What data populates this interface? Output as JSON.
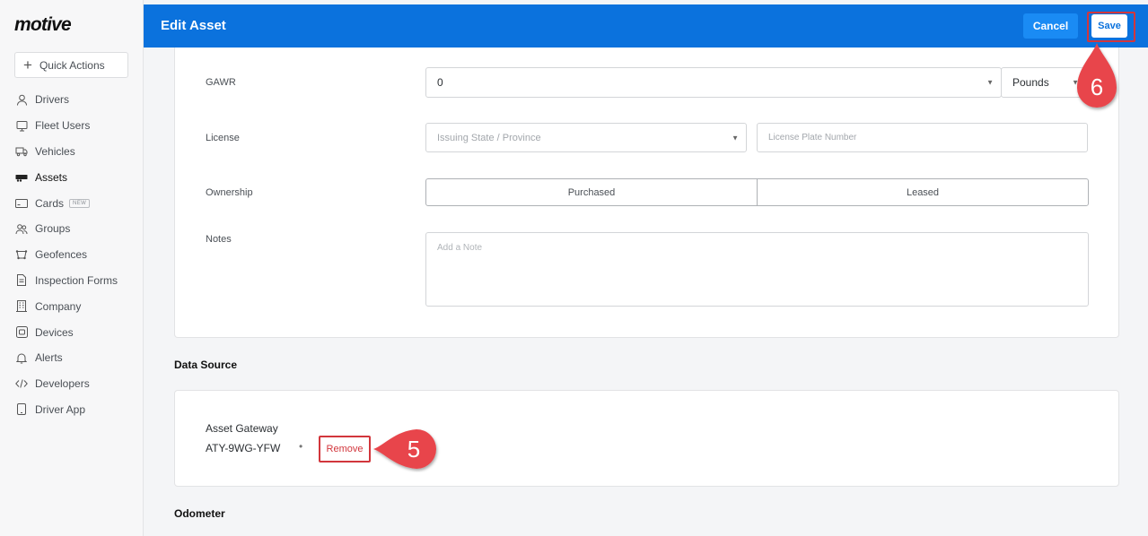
{
  "sidebar": {
    "logo": "motive",
    "quick_actions": "Quick Actions",
    "items": [
      {
        "label": "Drivers",
        "icon": "user-icon"
      },
      {
        "label": "Fleet Users",
        "icon": "monitor-icon"
      },
      {
        "label": "Vehicles",
        "icon": "truck-icon"
      },
      {
        "label": "Assets",
        "icon": "trailer-icon",
        "active": true
      },
      {
        "label": "Cards",
        "icon": "card-icon",
        "badge": "NEW"
      },
      {
        "label": "Groups",
        "icon": "users-icon"
      },
      {
        "label": "Geofences",
        "icon": "geofence-icon"
      },
      {
        "label": "Inspection Forms",
        "icon": "document-icon"
      },
      {
        "label": "Company",
        "icon": "building-icon"
      },
      {
        "label": "Devices",
        "icon": "device-icon"
      },
      {
        "label": "Alerts",
        "icon": "bell-icon"
      },
      {
        "label": "Developers",
        "icon": "code-icon"
      },
      {
        "label": "Driver App",
        "icon": "phone-icon"
      }
    ]
  },
  "header": {
    "title": "Edit Asset",
    "cancel": "Cancel",
    "save": "Save",
    "color": "#0b72dd"
  },
  "form": {
    "gawr_label": "GAWR",
    "gawr_value": "0",
    "gawr_unit": "Pounds",
    "license_label": "License",
    "license_state_placeholder": "Issuing State / Province",
    "license_plate_placeholder": "License Plate Number",
    "ownership_label": "Ownership",
    "ownership_options": [
      "Purchased",
      "Leased"
    ],
    "notes_label": "Notes",
    "notes_placeholder": "Add a Note"
  },
  "data_source": {
    "title": "Data Source",
    "gateway_label": "Asset Gateway",
    "gateway_id": "ATY-9WG-YFW",
    "separator": "•",
    "remove": "Remove"
  },
  "odometer": {
    "title": "Odometer"
  },
  "callouts": {
    "save_step": "6",
    "remove_step": "5",
    "color": "#e8454b"
  }
}
